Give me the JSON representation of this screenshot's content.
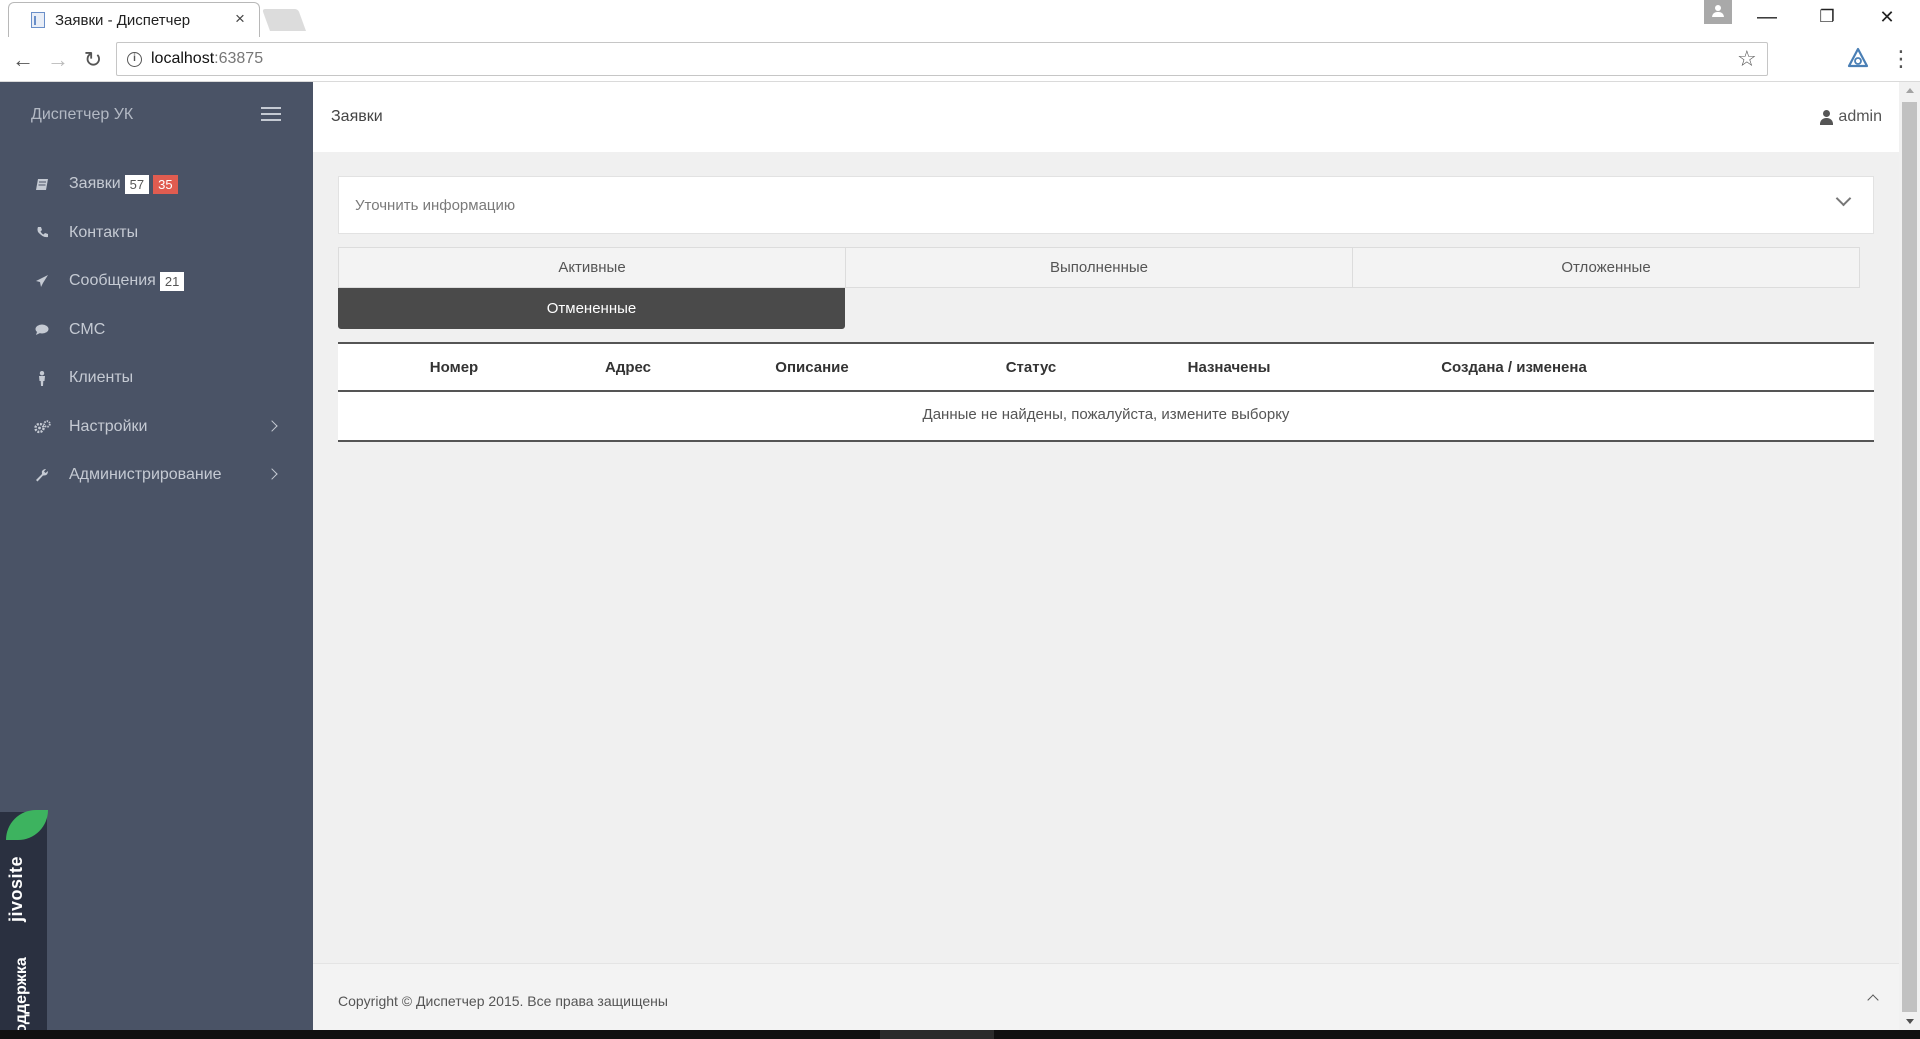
{
  "browser": {
    "tab_title": "Заявки - Диспетчер",
    "tab_close": "×",
    "url_host": "localhost",
    "url_port": ":63875",
    "back": "←",
    "forward": "→",
    "reload": "↻",
    "star": "☆",
    "menu": "⋮",
    "win_minimize": "—",
    "win_restore": "❐",
    "win_close": "✕"
  },
  "sidebar": {
    "brand": "Диспетчер УК",
    "items": [
      {
        "label": "Заявки",
        "icon": "book-icon",
        "badges": [
          "57",
          "35"
        ]
      },
      {
        "label": "Контакты",
        "icon": "phone-icon"
      },
      {
        "label": "Сообщения",
        "icon": "paper-plane-icon",
        "badges": [
          "21"
        ]
      },
      {
        "label": "СМС",
        "icon": "chat-bubble-icon"
      },
      {
        "label": "Клиенты",
        "icon": "person-icon"
      },
      {
        "label": "Настройки",
        "icon": "gears-icon",
        "has_submenu": true
      },
      {
        "label": "Администрирование",
        "icon": "wrench-icon",
        "has_submenu": true
      }
    ],
    "badge_colors": {
      "white": "#ffffff",
      "red": "#e05c50"
    }
  },
  "jivo": {
    "logo": "jivosite",
    "label": "Техподдержка",
    "leaf_color": "#3db35f"
  },
  "header": {
    "title": "Заявки",
    "user": "admin"
  },
  "filter": {
    "title": "Уточнить информацию"
  },
  "tabs": [
    {
      "label": "Активные",
      "active": false
    },
    {
      "label": "Выполненные",
      "active": false
    },
    {
      "label": "Отложенные",
      "active": false
    },
    {
      "label": "Отмененные",
      "active": true
    }
  ],
  "grid": {
    "columns": [
      "Номер",
      "Адрес",
      "Описание",
      "Статус",
      "Назначены",
      "Создана / изменена"
    ],
    "empty_message": "Данные не найдены, пожалуйста, измените выборку"
  },
  "footer": {
    "copyright": "Copyright © Диспетчер 2015. Все права защищены"
  },
  "colors": {
    "sidebar_bg": "#4a5366",
    "active_tab_bg": "#4a4a4a"
  }
}
